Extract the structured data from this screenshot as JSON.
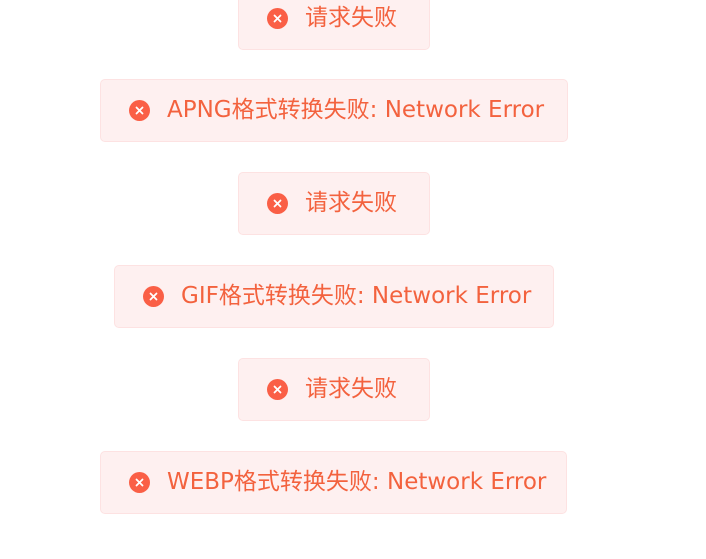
{
  "messages": [
    {
      "type": "error",
      "icon": "error-circle-icon",
      "text": "请求失败"
    },
    {
      "type": "error",
      "icon": "error-circle-icon",
      "text": "APNG格式转换失败: Network Error"
    },
    {
      "type": "error",
      "icon": "error-circle-icon",
      "text": "请求失败"
    },
    {
      "type": "error",
      "icon": "error-circle-icon",
      "text": "GIF格式转换失败: Network Error"
    },
    {
      "type": "error",
      "icon": "error-circle-icon",
      "text": "请求失败"
    },
    {
      "type": "error",
      "icon": "error-circle-icon",
      "text": "WEBP格式转换失败: Network Error"
    }
  ],
  "colors": {
    "error_text": "#f3623e",
    "error_icon": "#fa5f46",
    "error_background": "#fef0f0",
    "error_border": "#fde2e2"
  }
}
